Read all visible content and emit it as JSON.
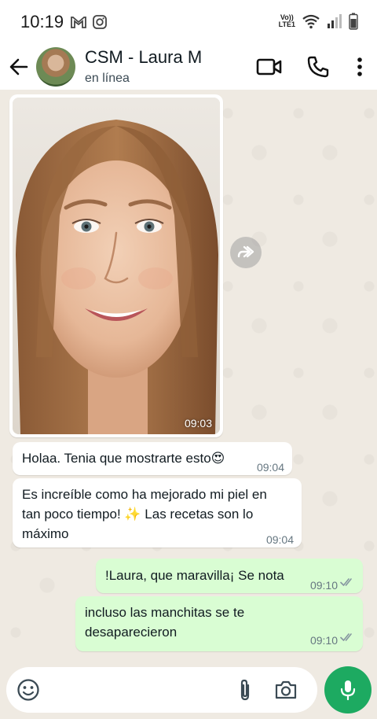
{
  "status_bar": {
    "time": "10:19",
    "network_label": "Vo)) LTE1"
  },
  "header": {
    "contact_name": "CSM - Laura M",
    "contact_status": "en línea"
  },
  "messages": [
    {
      "type": "image",
      "direction": "incoming",
      "time": "09:03"
    },
    {
      "type": "text",
      "direction": "incoming",
      "text": "Holaa. Tenia que mostrarte esto😍",
      "time": "09:04"
    },
    {
      "type": "text",
      "direction": "incoming",
      "lines": [
        "Es increíble como ha mejorado mi piel en",
        "tan poco tiempo! ✨ Las recetas son lo",
        "máximo"
      ],
      "time": "09:04"
    },
    {
      "type": "text",
      "direction": "outgoing",
      "text": "!Laura, que maravilla¡ Se nota",
      "time": "09:10",
      "status": "read"
    },
    {
      "type": "text",
      "direction": "outgoing",
      "lines": [
        "incluso las manchitas se te",
        "desaparecieron"
      ],
      "time": "09:10",
      "status": "read"
    }
  ],
  "input_bar": {
    "placeholder": ""
  },
  "icons": {
    "back": "arrow-left-icon",
    "video": "video-camera-icon",
    "call": "phone-icon",
    "menu": "more-vertical-icon",
    "emoji": "emoji-icon",
    "attach": "paperclip-icon",
    "camera": "camera-icon",
    "mic": "microphone-icon",
    "forward": "forward-icon"
  },
  "colors": {
    "chat_background": "#efeae2",
    "outgoing_bubble": "#d9fdd3",
    "incoming_bubble": "#ffffff",
    "accent_green": "#1daa61",
    "read_ticks": "#8696a0"
  }
}
